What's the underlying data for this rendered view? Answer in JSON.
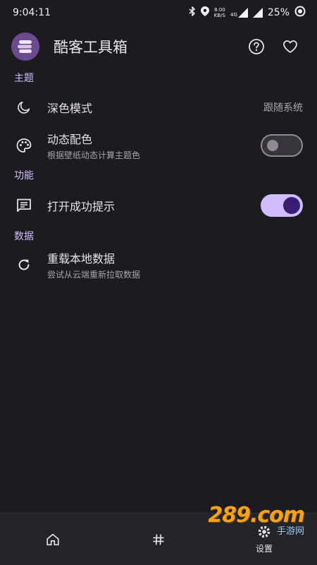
{
  "status_bar": {
    "time": "9:04:11",
    "net_speed_value": "8.00",
    "net_speed_unit": "KB/S",
    "network_type": "4G",
    "battery": "25%"
  },
  "app_bar": {
    "title": "酷客工具箱"
  },
  "sections": {
    "theme": {
      "header": "主题",
      "dark_mode": {
        "title": "深色模式",
        "value": "跟随系统"
      },
      "dynamic_color": {
        "title": "动态配色",
        "subtitle": "根据壁纸动态计算主题色",
        "enabled": false
      }
    },
    "features": {
      "header": "功能",
      "open_success_tip": {
        "title": "打开成功提示",
        "enabled": true
      }
    },
    "data": {
      "header": "数据",
      "reload": {
        "title": "重载本地数据",
        "subtitle": "尝试从云端重新拉取数据"
      }
    }
  },
  "bottom_nav": {
    "settings_label": "设置"
  },
  "watermark": {
    "brand": "289.com",
    "sub": "手游网"
  },
  "colors": {
    "background": "#1c1b1f",
    "accent": "#d0bcff",
    "accent_dark": "#381e72"
  }
}
